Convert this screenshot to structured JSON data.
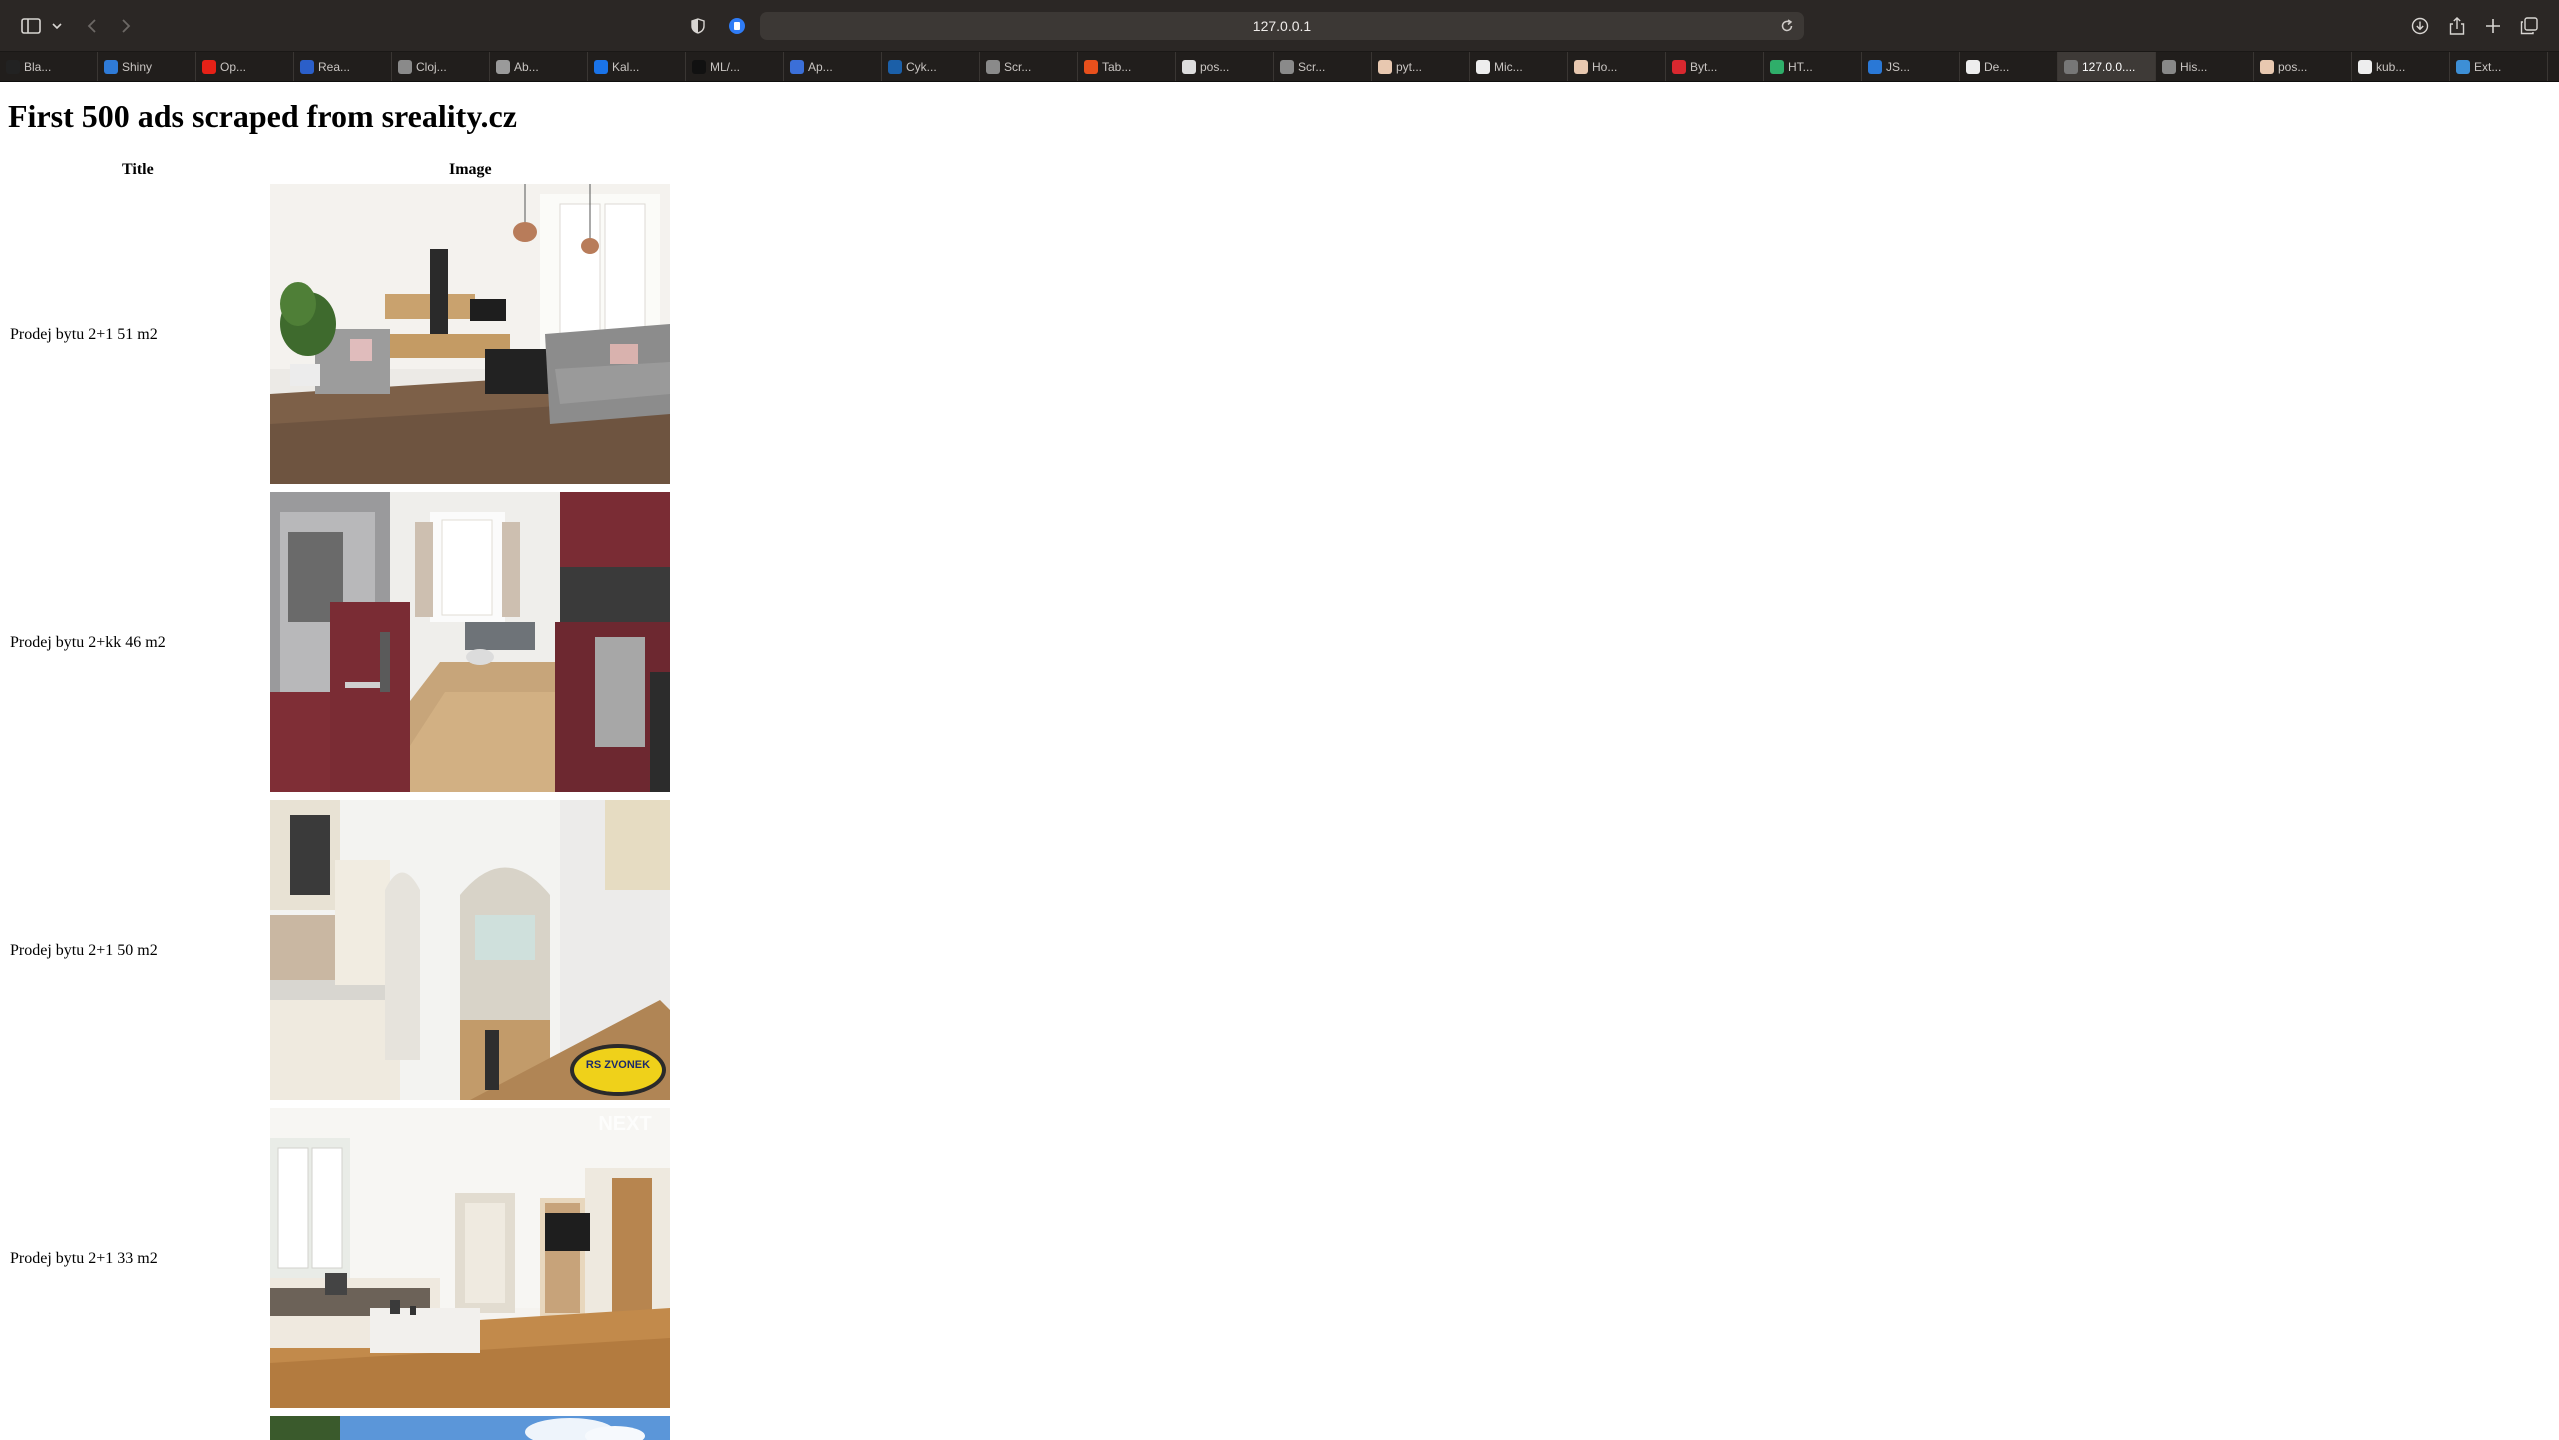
{
  "browser": {
    "url": "127.0.0.1",
    "tabs": [
      {
        "label": "Bla...",
        "icon": "tab-black-icon",
        "color": "#222222"
      },
      {
        "label": "Shiny",
        "icon": "shiny-icon",
        "color": "#2f7bd8"
      },
      {
        "label": "Op...",
        "icon": "youtube-icon",
        "color": "#e62117"
      },
      {
        "label": "Rea...",
        "icon": "doc-icon",
        "color": "#2b5fc9"
      },
      {
        "label": "Cloj...",
        "icon": "clojure-icon",
        "color": "#8a8a8a"
      },
      {
        "label": "Ab...",
        "icon": "k-icon",
        "color": "#9a9a9a"
      },
      {
        "label": "Kal...",
        "icon": "calendar-icon",
        "color": "#1a73e8"
      },
      {
        "label": "ML/...",
        "icon": "ml-icon",
        "color": "#111111"
      },
      {
        "label": "Ap...",
        "icon": "docs-icon",
        "color": "#3b6fd8"
      },
      {
        "label": "Cyk...",
        "icon": "cyk-icon",
        "color": "#1b5fa8"
      },
      {
        "label": "Scr...",
        "icon": "sheet-icon",
        "color": "#8a8a8a"
      },
      {
        "label": "Tab...",
        "icon": "tab-icon",
        "color": "#e8501c"
      },
      {
        "label": "pos...",
        "icon": "postgres-icon",
        "color": "#dddddd"
      },
      {
        "label": "Scr...",
        "icon": "sheet-icon",
        "color": "#8a8a8a"
      },
      {
        "label": "pyt...",
        "icon": "python-icon",
        "color": "#e8c8b0"
      },
      {
        "label": "Mic...",
        "icon": "github-icon",
        "color": "#eeeeee"
      },
      {
        "label": "Ho...",
        "icon": "home-icon",
        "color": "#e8c8b0"
      },
      {
        "label": "Byt...",
        "icon": "sreality-icon",
        "color": "#d9282f"
      },
      {
        "label": "HT...",
        "icon": "html-icon",
        "color": "#2fae6a"
      },
      {
        "label": "JS...",
        "icon": "js-icon",
        "color": "#2a78d6"
      },
      {
        "label": "De...",
        "icon": "dev-icon",
        "color": "#eeeeee"
      },
      {
        "label": "127.0.0....",
        "icon": "local-icon",
        "color": "#777777"
      },
      {
        "label": "His...",
        "icon": "history-icon",
        "color": "#888888"
      },
      {
        "label": "pos...",
        "icon": "post-icon",
        "color": "#e8c8b0"
      },
      {
        "label": "kub...",
        "icon": "github-icon",
        "color": "#eeeeee"
      },
      {
        "label": "Ext...",
        "icon": "ext-icon",
        "color": "#3d8fd6"
      }
    ],
    "active_tab_index": 21
  },
  "page": {
    "heading": "First 500 ads scraped from sreality.cz",
    "columns": {
      "title": "Title",
      "image": "Image"
    },
    "rows": [
      {
        "title": "Prodej bytu 2+1 51 m2",
        "image": "living-room-photo"
      },
      {
        "title": "Prodej bytu 2+kk 46 m2",
        "image": "kitchen-photo"
      },
      {
        "title": "Prodej bytu 2+1 50 m2",
        "image": "kitchen-arch-photo"
      },
      {
        "title": "Prodej bytu 2+1 33 m2",
        "image": "lounge-photo"
      },
      {
        "title": "",
        "image": "exterior-photo"
      }
    ],
    "image_stamps": {
      "zvonek": "RS ZVONEK",
      "next": "NEXT"
    }
  }
}
